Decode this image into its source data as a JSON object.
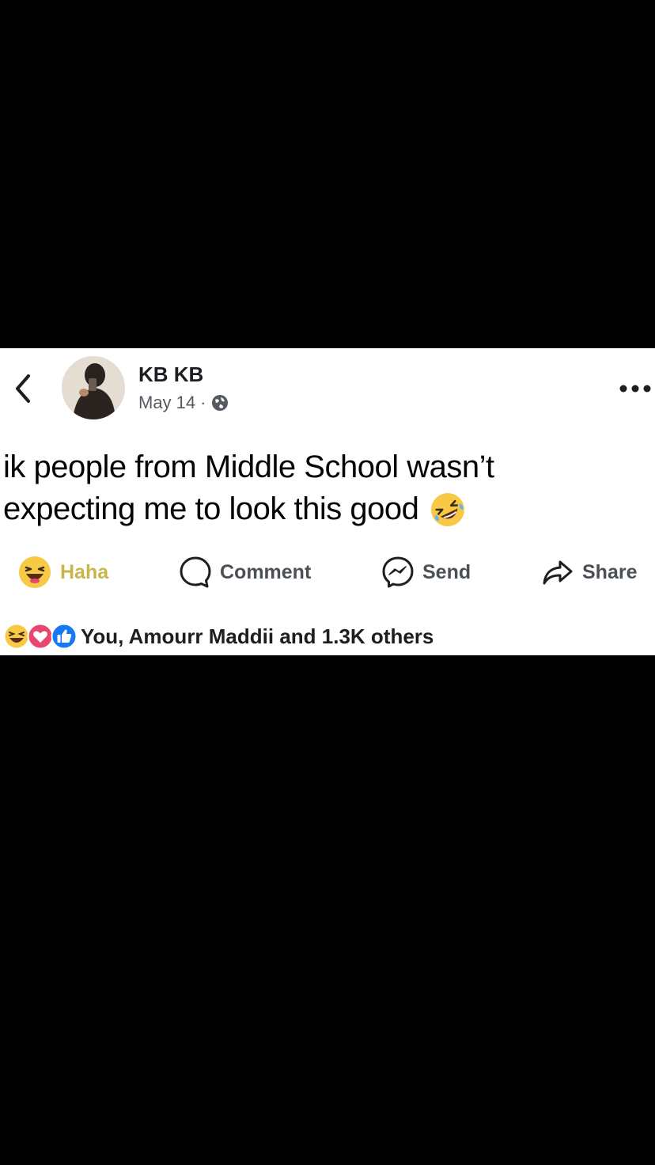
{
  "post": {
    "author": "KB KB",
    "date": "May 14",
    "separator": "·",
    "text_line1": "ik people from Middle School wasn’t",
    "text_line2": "expecting me to look this good",
    "emoji": "rolling-on-floor-laughing"
  },
  "actions": {
    "haha_label": "Haha",
    "comment_label": "Comment",
    "send_label": "Send",
    "share_label": "Share"
  },
  "reactions": {
    "icons": [
      "haha-icon",
      "love-icon",
      "like-icon"
    ],
    "summary": "You, Amourr Maddii and 1.3K others"
  },
  "colors": {
    "haha_active": "#c9b64a",
    "like_blue": "#1877f2",
    "love_red": "#e8466c",
    "haha_yellow": "#f7c944"
  }
}
